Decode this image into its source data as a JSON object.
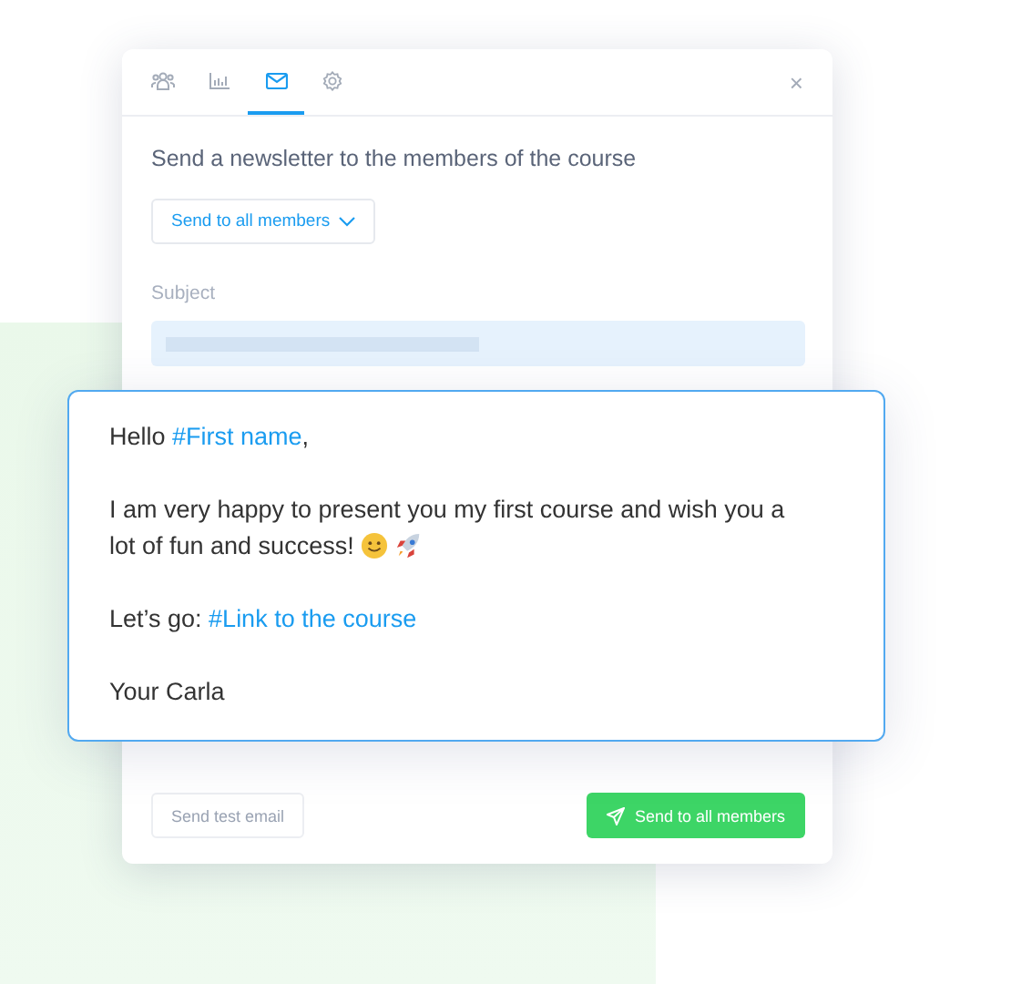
{
  "tabs": [
    {
      "kind": "people",
      "selected": false
    },
    {
      "kind": "chart",
      "selected": false
    },
    {
      "kind": "mail",
      "selected": true
    },
    {
      "kind": "gear",
      "selected": false
    }
  ],
  "close": "×",
  "heading": "Send a newsletter to the members of the course",
  "audience_dropdown": "Send to all members",
  "subject": {
    "label": "Subject"
  },
  "message": [
    [
      {
        "kind": "text",
        "text": "Hello "
      },
      {
        "kind": "tag",
        "text": "#First name"
      },
      {
        "kind": "text",
        "text": ","
      }
    ],
    [
      {
        "kind": "text",
        "text": "I am very happy to present you my first course and wish you a lot of fun and success! "
      },
      {
        "kind": "smile"
      },
      {
        "kind": "rocket"
      }
    ],
    [
      {
        "kind": "text",
        "text": "Let’s go: "
      },
      {
        "kind": "tag",
        "text": "#Link to the course"
      }
    ],
    [
      {
        "kind": "text",
        "text": "Your Carla"
      }
    ]
  ],
  "buttons": {
    "test": "Send test email",
    "send": "Send to all members"
  }
}
